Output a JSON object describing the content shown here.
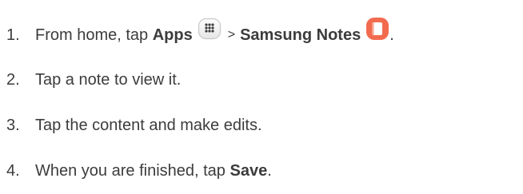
{
  "steps": [
    {
      "number": "1.",
      "text_before": "From home, tap ",
      "bold_1": "Apps",
      "separator": ">",
      "bold_2": "Samsung Notes",
      "trailing": ".",
      "icons": [
        "apps-icon",
        "samsung-notes-icon"
      ]
    },
    {
      "number": "2.",
      "text": "Tap a note to view it."
    },
    {
      "number": "3.",
      "text": "Tap the content and make edits."
    },
    {
      "number": "4.",
      "text_before": "When you are finished, tap ",
      "bold": "Save",
      "trailing": "."
    }
  ],
  "colors": {
    "text": "#3c3c3c",
    "notes_icon": "#f26b4f",
    "apps_icon_border": "#c8c8c8",
    "apps_icon_dots": "#3c3c3c"
  }
}
